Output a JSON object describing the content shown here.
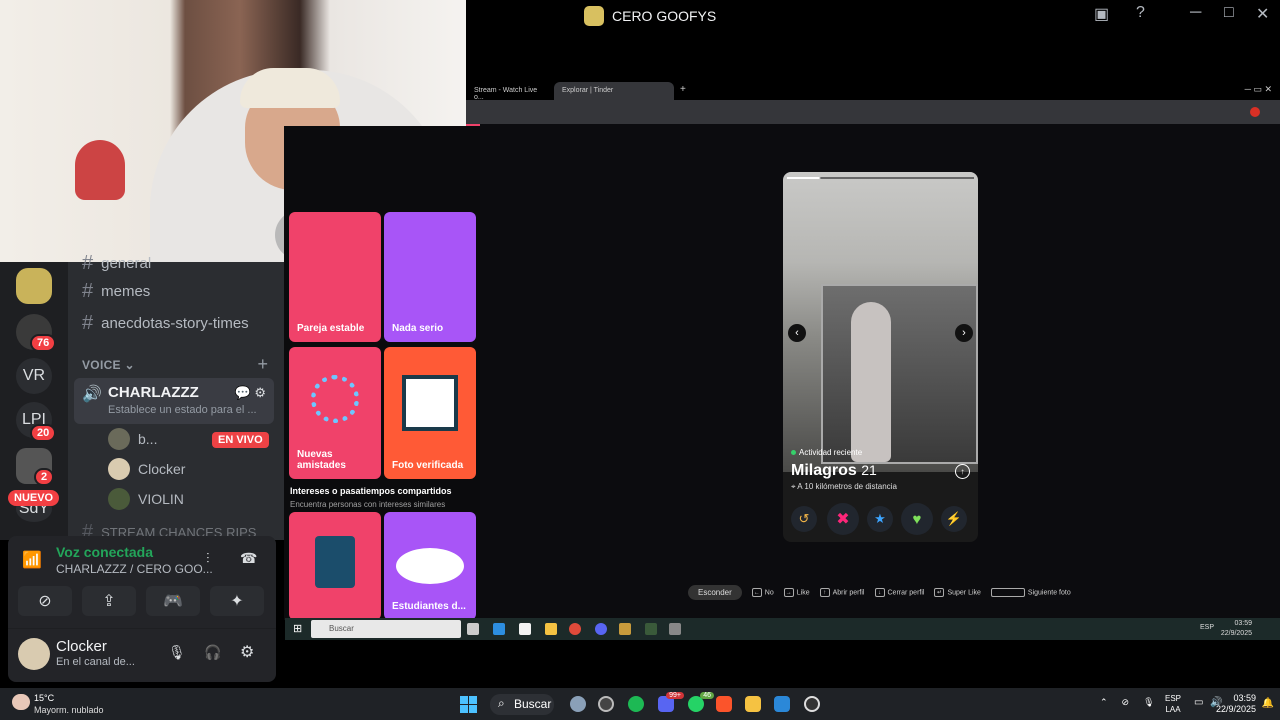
{
  "window": {
    "title": "CERO GOOFYS"
  },
  "discord": {
    "guilds": [
      {
        "label": "",
        "badge": ""
      },
      {
        "label": "",
        "badge": "76"
      },
      {
        "label": "VR",
        "badge": ""
      },
      {
        "label": "LPI",
        "badge": "20"
      },
      {
        "label": "",
        "badge": "2"
      },
      {
        "label": "SdY",
        "badge": ""
      }
    ],
    "new_badge": "NUEVO",
    "channels": [
      {
        "label": "general"
      },
      {
        "label": "memes"
      },
      {
        "label": "anecdotas-story-times"
      }
    ],
    "voice_header": "VOICE",
    "voice_channel": {
      "name": "CHARLAZZZ",
      "status": "Establece un estado para el ..."
    },
    "members": [
      {
        "name": "b...",
        "live": "EN VIVO"
      },
      {
        "name": "Clocker"
      },
      {
        "name": "VIOLIN"
      }
    ],
    "cut_channel": "STREAM CHANCES RIPS",
    "voice_panel": {
      "connected": "Voz conectada",
      "location": "CHARLAZZZ / CERO GOO..."
    },
    "user": {
      "name": "Clocker",
      "status": "En el canal de..."
    }
  },
  "browser": {
    "tabs": [
      {
        "label": "Stream - Watch Live o..."
      },
      {
        "label": "Explorar | Tinder"
      }
    ]
  },
  "tinder": {
    "cards": [
      {
        "label": "Pareja estable",
        "color": "#f0426a"
      },
      {
        "label": "Nada serio",
        "color": "#a855f7"
      },
      {
        "label": "Nuevas amistades",
        "color": "#f0426a"
      },
      {
        "label": "Foto verificada",
        "color": "#ff5a36"
      },
      {
        "label": "",
        "color": "#f0426a"
      },
      {
        "label": "Estudiantes d...",
        "color": "#a855f7"
      }
    ],
    "shared_title": "Intereses o pasatiempos compartidos",
    "shared_sub": "Encuentra personas con intereses similares",
    "profile": {
      "activity": "Actividad reciente",
      "name": "Milagros",
      "age": "21",
      "distance": "A 10 kilómetros de distancia"
    },
    "shortcuts": {
      "hide": "Esconder",
      "no": "No",
      "like": "Like",
      "open": "Abrir perfil",
      "close": "Cerrar perfil",
      "super": "Super Like",
      "next": "Siguiente foto"
    }
  },
  "inner_taskbar": {
    "search": "Buscar",
    "lang": "ESP",
    "time": "03:59",
    "date": "22/9/2025"
  },
  "taskbar": {
    "weather_temp": "15°C",
    "weather_desc": "Mayorm. nublado",
    "search": "Buscar",
    "badge_discord": "99+",
    "badge_whatsapp": "46",
    "lang_top": "ESP",
    "lang_bottom": "LAA",
    "time": "03:59",
    "date": "22/9/2025"
  }
}
